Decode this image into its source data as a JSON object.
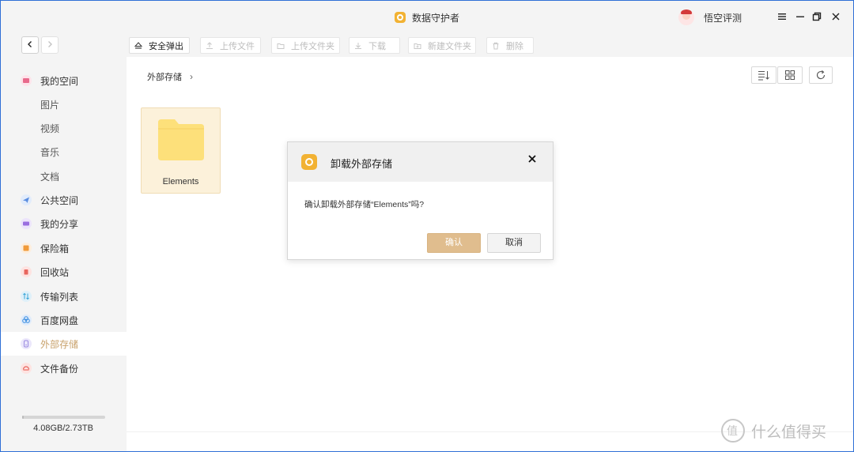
{
  "window": {
    "title": "数据守护者",
    "user_name": "悟空评测",
    "controls": {
      "menu": "☰",
      "minimize": "—",
      "restore": "❐",
      "close": "✕"
    }
  },
  "toolbar": {
    "back": "‹",
    "forward": "›",
    "buttons": [
      {
        "label": "安全弹出",
        "enabled": true,
        "icon": "eject-icon"
      },
      {
        "label": "上传文件",
        "enabled": false,
        "icon": "upload-file-icon"
      },
      {
        "label": "上传文件夹",
        "enabled": false,
        "icon": "upload-folder-icon"
      },
      {
        "label": "下载",
        "enabled": false,
        "icon": "download-icon"
      },
      {
        "label": "新建文件夹",
        "enabled": false,
        "icon": "new-folder-icon"
      },
      {
        "label": "删除",
        "enabled": false,
        "icon": "delete-icon"
      }
    ]
  },
  "sidebar": {
    "items": [
      {
        "label": "我的空间",
        "icon": "my-space-icon",
        "color": "#e86a8c"
      },
      {
        "label": "图片",
        "sub": true
      },
      {
        "label": "视频",
        "sub": true
      },
      {
        "label": "音乐",
        "sub": true
      },
      {
        "label": "文档",
        "sub": true
      },
      {
        "label": "公共空间",
        "icon": "public-space-icon",
        "color": "#5a8de0"
      },
      {
        "label": "我的分享",
        "icon": "share-icon",
        "color": "#9a6ee0"
      },
      {
        "label": "保险箱",
        "icon": "safe-icon",
        "color": "#f09a3a"
      },
      {
        "label": "回收站",
        "icon": "recycle-bin-icon",
        "color": "#e8665e"
      },
      {
        "label": "传输列表",
        "icon": "transfer-list-icon",
        "color": "#3aa6d8"
      },
      {
        "label": "百度网盘",
        "icon": "baidu-disk-icon",
        "color": "#3a8de0"
      },
      {
        "label": "外部存储",
        "icon": "external-storage-icon",
        "color": "#9a8ae0",
        "selected": true
      },
      {
        "label": "文件备份",
        "icon": "file-backup-icon",
        "color": "#e8665e"
      }
    ],
    "storage_text": "4.08GB/2.73TB",
    "storage_used_fraction": 0.0015
  },
  "main": {
    "breadcrumb": "外部存储",
    "breadcrumb_sep": "›",
    "folders": [
      {
        "name": "Elements"
      }
    ]
  },
  "dialog": {
    "title": "卸载外部存储",
    "message": "确认卸载外部存储“Elements”吗?",
    "ok": "确认",
    "cancel": "取消",
    "close": "✕"
  },
  "watermark": "什么值得买",
  "colors": {
    "accent": "#e0bd8e",
    "folder": "#fde07a",
    "selected_text": "#c8a16b"
  }
}
